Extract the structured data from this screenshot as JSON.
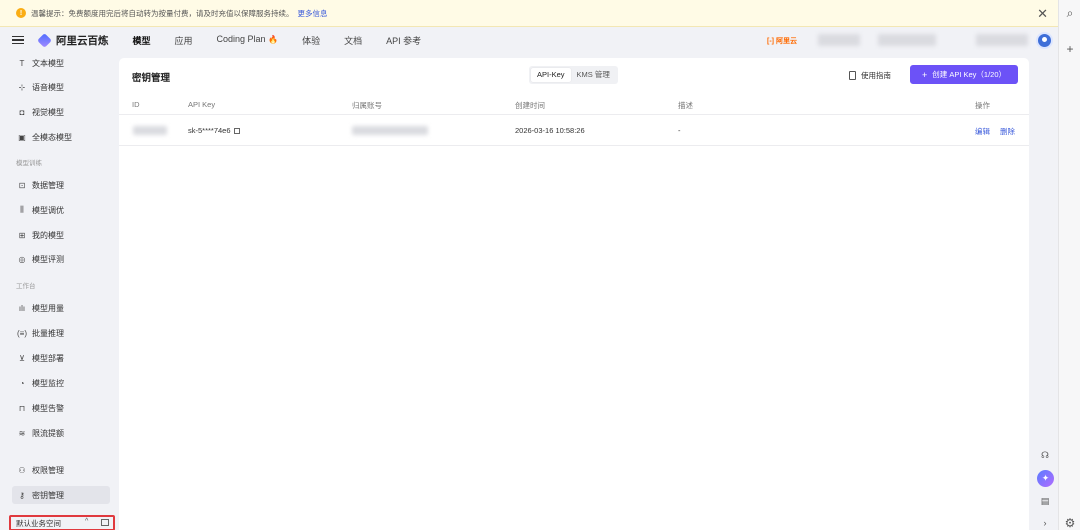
{
  "notice": {
    "text": "温馨提示：免费额度用完后将自动转为按量付费，请及时充值以保障服务持续。",
    "link": "更多信息"
  },
  "header": {
    "logo": "阿里云百炼",
    "nav": [
      {
        "label": "模型",
        "active": true
      },
      {
        "label": "应用",
        "active": false
      },
      {
        "label": "Coding Plan",
        "active": false
      },
      {
        "label": "体验",
        "active": false
      },
      {
        "label": "文档",
        "active": false
      },
      {
        "label": "API 参考",
        "active": false
      }
    ],
    "brand": "[-] 阿里云"
  },
  "sidebar": {
    "items_top": [
      {
        "icon": "T",
        "label": "文本模型"
      },
      {
        "icon": "⊹",
        "label": "语音模型"
      },
      {
        "icon": "◘",
        "label": "视觉模型"
      },
      {
        "icon": "▣",
        "label": "全模态模型"
      }
    ],
    "group_train": "模型训练",
    "items_train": [
      {
        "icon": "⊡",
        "label": "数据管理"
      },
      {
        "icon": "⫼",
        "label": "模型调优"
      },
      {
        "icon": "⊞",
        "label": "我的模型"
      },
      {
        "icon": "◎",
        "label": "模型评测"
      }
    ],
    "group_work": "工作台",
    "items_work": [
      {
        "icon": "ılı",
        "label": "模型用量"
      },
      {
        "icon": "(≡)",
        "label": "批量推理"
      },
      {
        "icon": "⊻",
        "label": "模型部署"
      },
      {
        "icon": "◔",
        "label": "模型监控"
      },
      {
        "icon": "⊓",
        "label": "模型告警"
      },
      {
        "icon": "≋",
        "label": "限流提额"
      }
    ],
    "items_bottom": [
      {
        "icon": "⚇",
        "label": "权限管理",
        "active": false
      },
      {
        "icon": "⚷",
        "label": "密钥管理",
        "active": true
      }
    ],
    "workspace": "默认业务空间"
  },
  "main": {
    "title": "密钥管理",
    "tabs": [
      {
        "label": "API-Key",
        "active": true
      },
      {
        "label": "KMS 管理",
        "active": false
      }
    ],
    "guide": "使用指南",
    "create": "创建 API Key（1/20）",
    "columns": [
      "ID",
      "API Key",
      "归属账号",
      "创建时间",
      "描述",
      "操作"
    ],
    "rows": [
      {
        "api_key": "sk-5****74e6",
        "created": "2026-03-16 10:58:26",
        "desc": "-",
        "edit": "编辑",
        "delete": "删除"
      }
    ]
  },
  "icons": {
    "browser_search": "search-icon",
    "browser_add": "plus-icon",
    "support": "headset-icon",
    "assistant": "sparkle-icon",
    "doc": "document-icon"
  },
  "colors": {
    "accent": "#6c52f7",
    "link": "#3b5bdb",
    "highlight_border": "#e0393e",
    "notice_bg": "#fffbe6"
  }
}
